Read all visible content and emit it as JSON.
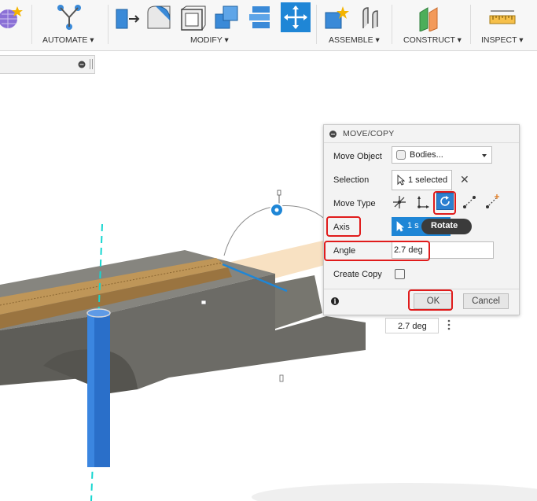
{
  "toolbar": {
    "groups": {
      "automate": "AUTOMATE ▾",
      "modify": "MODIFY ▾",
      "assemble": "ASSEMBLE ▾",
      "construct": "CONSTRUCT ▾",
      "inspect": "INSPECT ▾"
    }
  },
  "dialog": {
    "title": "MOVE/COPY",
    "move_object_label": "Move Object",
    "move_object_value": "Bodies...",
    "selection_label": "Selection",
    "selection_value": "1 selected",
    "move_type_label": "Move Type",
    "axis_label": "Axis",
    "axis_value": "1 s",
    "tooltip": "Rotate",
    "angle_label": "Angle",
    "angle_value": "2.7 deg",
    "create_copy_label": "Create Copy",
    "ok_label": "OK",
    "cancel_label": "Cancel"
  },
  "viewport": {
    "angle_tag": "2.7 deg"
  },
  "colors": {
    "accent_blue": "#1f86d6",
    "highlight_red": "#e01b1b",
    "body_gray": "#6e6d68",
    "plank_orange": "#c7a06a",
    "cylinder_blue": "#2a6fc9"
  }
}
